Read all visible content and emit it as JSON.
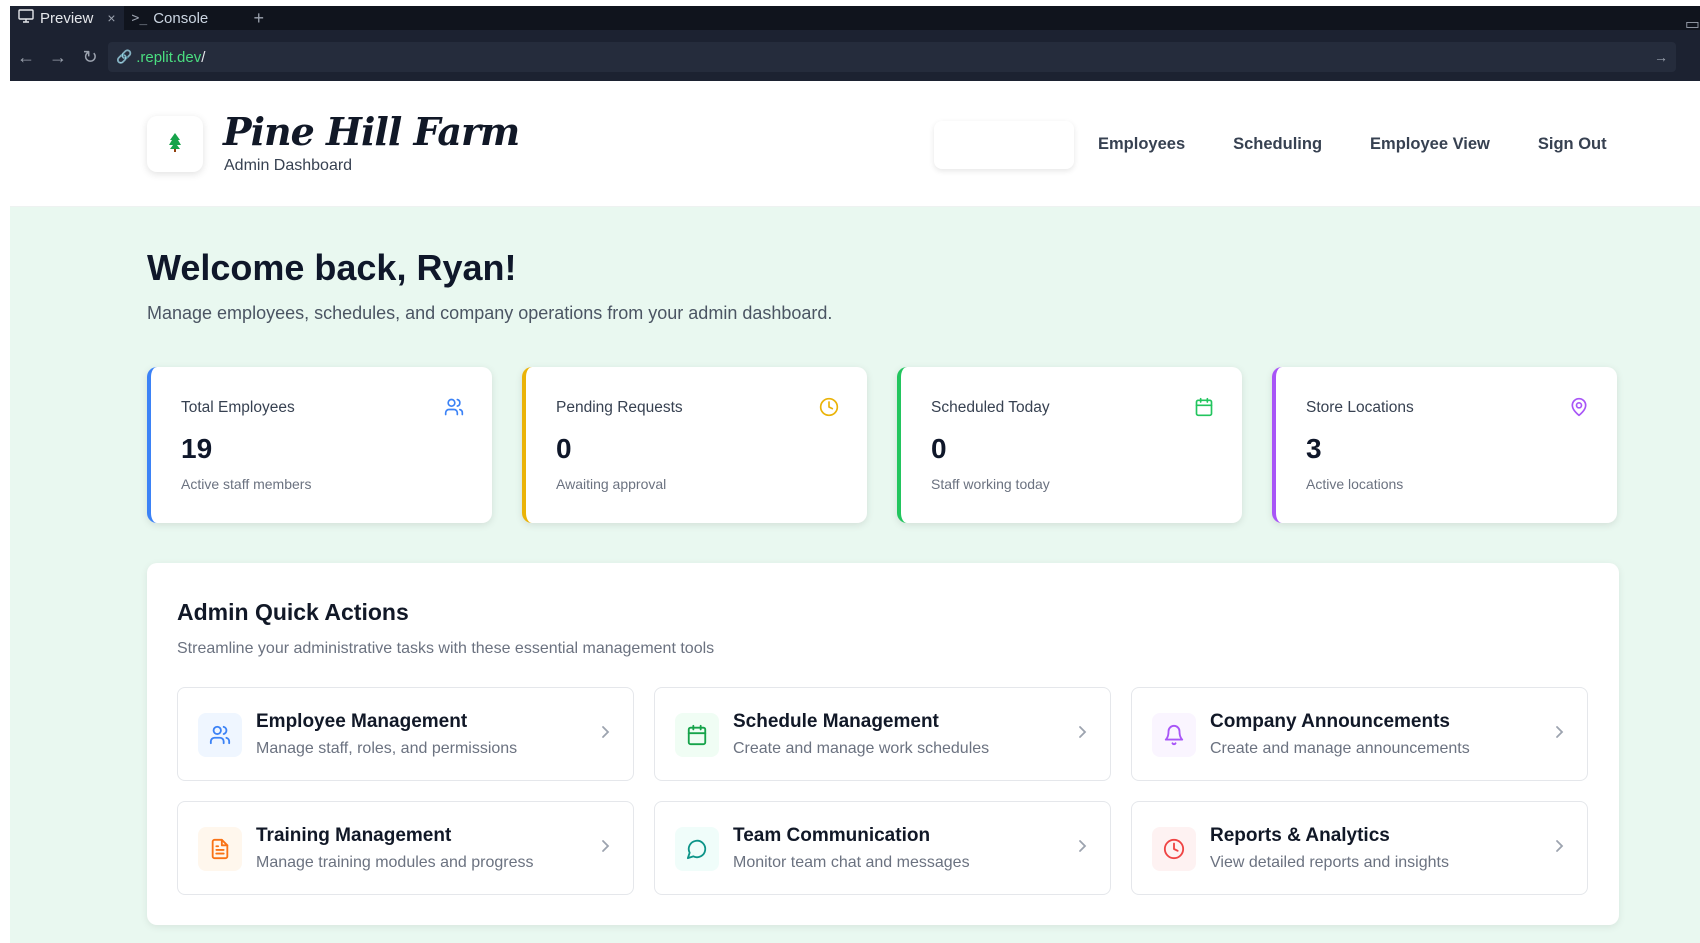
{
  "browser": {
    "tabs": [
      {
        "label": "Preview",
        "icon": "monitor-icon",
        "close": "×"
      },
      {
        "label": "Console",
        "icon": "terminal-icon"
      }
    ],
    "new_tab": "+",
    "url_domain": ".replit.dev",
    "url_path": "/"
  },
  "header": {
    "brand": "Pine Hill Farm",
    "subtitle": "Admin Dashboard",
    "logo_icon": "pine-tree-icon",
    "nav": [
      "Employees",
      "Scheduling",
      "Employee View",
      "Sign Out"
    ]
  },
  "welcome": {
    "title": "Welcome back, Ryan!",
    "subtitle": "Manage employees, schedules, and company operations from your admin dashboard."
  },
  "stats": [
    {
      "label": "Total Employees",
      "value": "19",
      "desc": "Active staff members",
      "icon": "users-icon",
      "color": "#3b82f6"
    },
    {
      "label": "Pending Requests",
      "value": "0",
      "desc": "Awaiting approval",
      "icon": "clock-icon",
      "color": "#eab308"
    },
    {
      "label": "Scheduled Today",
      "value": "0",
      "desc": "Staff working today",
      "icon": "calendar-icon",
      "color": "#22c55e"
    },
    {
      "label": "Store Locations",
      "value": "3",
      "desc": "Active locations",
      "icon": "map-pin-icon",
      "color": "#a855f7"
    }
  ],
  "quick_actions": {
    "title": "Admin Quick Actions",
    "subtitle": "Streamline your administrative tasks with these essential management tools",
    "items": [
      {
        "title": "Employee Management",
        "desc": "Manage staff, roles, and permissions",
        "icon": "users-icon",
        "color": "#3b82f6",
        "bg": "#eff6ff"
      },
      {
        "title": "Schedule Management",
        "desc": "Create and manage work schedules",
        "icon": "calendar-icon",
        "color": "#16a34a",
        "bg": "#f0fdf4"
      },
      {
        "title": "Company Announcements",
        "desc": "Create and manage announcements",
        "icon": "bell-icon",
        "color": "#a855f7",
        "bg": "#faf5ff"
      },
      {
        "title": "Training Management",
        "desc": "Manage training modules and progress",
        "icon": "file-text-icon",
        "color": "#f97316",
        "bg": "#fff7ed"
      },
      {
        "title": "Team Communication",
        "desc": "Monitor team chat and messages",
        "icon": "message-circle-icon",
        "color": "#0d9488",
        "bg": "#f0fdfa"
      },
      {
        "title": "Reports & Analytics",
        "desc": "View detailed reports and insights",
        "icon": "clock-icon",
        "color": "#ef4444",
        "bg": "#fef2f2"
      }
    ]
  }
}
